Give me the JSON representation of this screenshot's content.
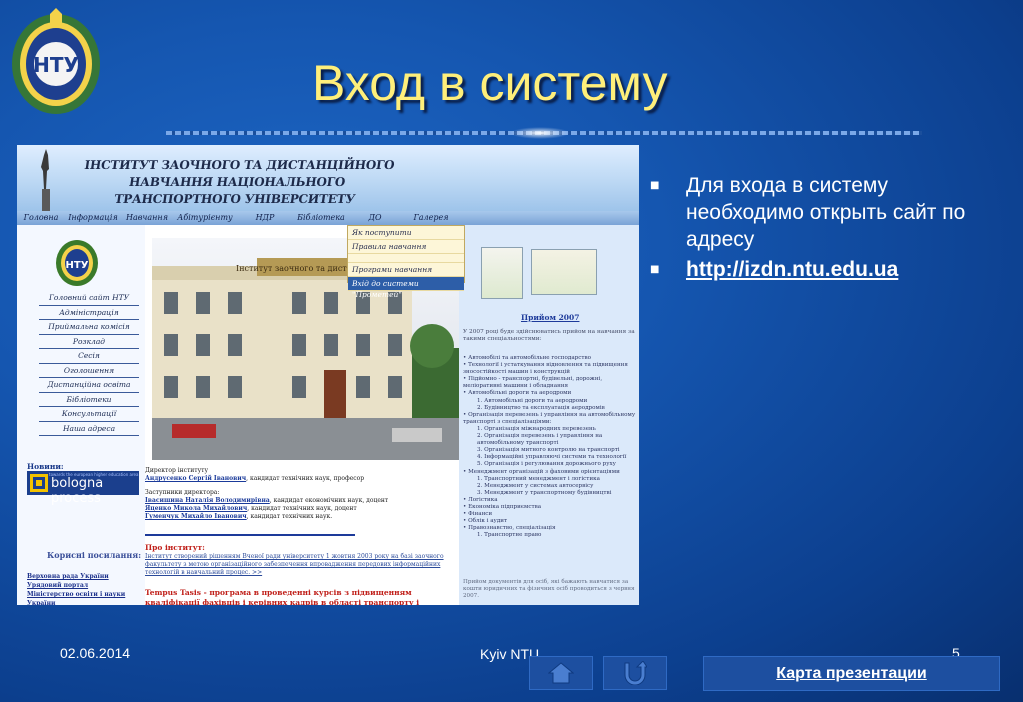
{
  "slide": {
    "title": "Вход в систему",
    "logo_text": "НТУ",
    "bullets": [
      "Для входа в систему необходимо открыть сайт по адресу",
      "http://izdn.ntu.edu.ua"
    ]
  },
  "website": {
    "header_title": "ІНСТИТУТ ЗАОЧНОГО ТА ДИСТАНЦІЙНОГО НАВЧАННЯ НАЦІОНАЛЬНОГО ТРАНСПОРТНОГО УНІВЕРСИТЕТУ",
    "nav": [
      "Головна",
      "Інформація",
      "Навчання",
      "Абітурієнту",
      "НДР",
      "Бібліотека",
      "ДО",
      "Галерея"
    ],
    "dropdown": [
      "Як поступити",
      "Правила навчання",
      "",
      "Програми навчання",
      "Вхід до системи \"Прометей\""
    ],
    "logo_text": "НТУ",
    "side_menu": [
      "Головний сайт НТУ",
      "Адміністрація",
      "Приймальна комісія",
      "Розклад",
      "Сесія",
      "Оголошення",
      "Дистанційна освіта",
      "Бібліотеки",
      "Консультації",
      "Наша адреса"
    ],
    "news_label": "Новини:",
    "bologna_small": "towards the european higher education area",
    "bologna_text": "bologna process",
    "useful_links_label": "Корисні посилання:",
    "useful_links": [
      "Верховна рада України",
      "Урядовий портал",
      "Міністерство освіти і науки України"
    ],
    "photo_sign": "Інститут заочного та дистанційного навчання",
    "director": {
      "role": "Директор інституту",
      "name": "Андрусенко Сергій Іванович",
      "degree": ", кандидат технічних наук, професор",
      "deputies_label": "Заступники директора:",
      "deputies": [
        {
          "name": "Івасишина Наталія Володимирівна",
          "degree": ", кандидат економічних наук, доцент"
        },
        {
          "name": "Яценко Микола Михайлович",
          "degree": ", кандидат технічних наук, доцент"
        },
        {
          "name": "Гуменчук Михайло Іванович",
          "degree": ", кандидат технічних наук."
        }
      ]
    },
    "about_heading": "Про інститут:",
    "about_text": "Інститут створений рішенням Вченої ради університету 1 жовтня 2003 року на базі заочного факультету з метою організаційного забезпечення впровадження передових інформаційних технологій в навчальний процес. >>",
    "tempus_heading": "Tempus Tasis",
    "tempus_text": " - програма в проведенні курсів з підвищенням кваліфікації фахівців і керівних кадрів в області транспорту і логістики:",
    "admission_title": "Прийом 2007",
    "admission_text": "У 2007 році буде здійснюватись прийом на навчання за такими спеціальностями:",
    "admission_list": [
      {
        "text": "• Автомобілі та автомобільне господарство",
        "sub": false
      },
      {
        "text": "• Технології і устаткування відновлення та підвищення зносостійкості машин і конструкцій",
        "sub": false
      },
      {
        "text": "• Підйомно - транспортні, будівельні, дорожні, меліоративні машини і обладнання",
        "sub": false
      },
      {
        "text": "• Автомобільні дороги та аеродроми",
        "sub": false
      },
      {
        "text": "1. Автомобільні дороги та аеродроми",
        "sub": true
      },
      {
        "text": "2. Будівництво та експлуатація аеродромів",
        "sub": true
      },
      {
        "text": "• Організація перевезень і управління на автомобільному транспорті з спеціалізаціями:",
        "sub": false
      },
      {
        "text": "1. Організація міжнародних перевезень",
        "sub": true
      },
      {
        "text": "2. Організація перевезень і управління на автомобільному транспорті",
        "sub": true
      },
      {
        "text": "3. Організація митного контролю на транспорті",
        "sub": true
      },
      {
        "text": "4. Інформаційні управляючі системи та технології",
        "sub": true
      },
      {
        "text": "5. Організація і регулювання дорожнього руху",
        "sub": true
      },
      {
        "text": "• Менеджмент організацій з фаховими орієнтаціями",
        "sub": false
      },
      {
        "text": "1. Транспортний менеджмент і логістика",
        "sub": true
      },
      {
        "text": "2. Менеджмент у системах автосервісу",
        "sub": true
      },
      {
        "text": "3. Менеджмент у транспортному будівництві",
        "sub": true
      },
      {
        "text": "• Логістика",
        "sub": false
      },
      {
        "text": "• Економіка підприємства",
        "sub": false
      },
      {
        "text": "• Фінанси",
        "sub": false
      },
      {
        "text": "• Облік і аудит",
        "sub": false
      },
      {
        "text": "• Правознавство, спеціалізація",
        "sub": false
      },
      {
        "text": "1. Транспортне право",
        "sub": true
      }
    ],
    "admission_footer": "Прийом документів для осіб, які бажають навчатися за кошти юридичних та фізичних осіб проводиться з червня 2007."
  },
  "footer": {
    "date": "02.06.2014",
    "center": "Kyiv NTU",
    "page": "5",
    "map_button": "Карта презентации"
  },
  "colors": {
    "title": "#ffef7a",
    "background": "#1556b0",
    "button": "#1d4fa0"
  }
}
